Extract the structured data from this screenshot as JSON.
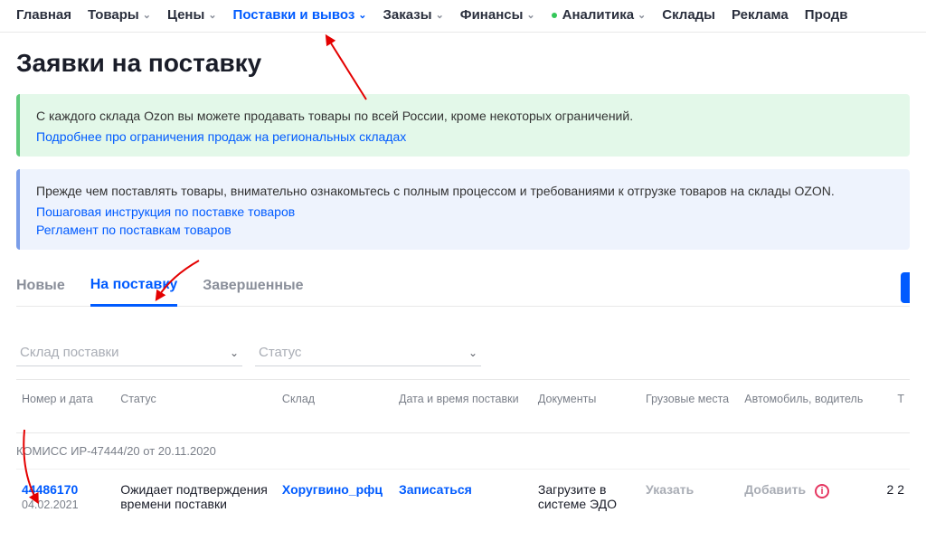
{
  "nav": {
    "items": [
      {
        "label": "Главная",
        "dropdown": false
      },
      {
        "label": "Товары",
        "dropdown": true
      },
      {
        "label": "Цены",
        "dropdown": true
      },
      {
        "label": "Поставки и вывоз",
        "dropdown": true,
        "active": true
      },
      {
        "label": "Заказы",
        "dropdown": true
      },
      {
        "label": "Финансы",
        "dropdown": true
      },
      {
        "label": "Аналитика",
        "dropdown": true,
        "dot": true
      },
      {
        "label": "Склады",
        "dropdown": false
      },
      {
        "label": "Реклама",
        "dropdown": false
      },
      {
        "label": "Продв",
        "dropdown": false
      }
    ]
  },
  "page": {
    "title": "Заявки на поставку"
  },
  "banner_green": {
    "text": "С каждого склада Ozon вы можете продавать товары по всей России, кроме некоторых ограничений.",
    "link": "Подробнее про ограничения продаж на региональных складах"
  },
  "banner_blue": {
    "text": "Прежде чем поставлять товары, внимательно ознакомьтесь с полным процессом и требованиями к отгрузке товаров на склады OZON.",
    "link1": "Пошаговая инструкция по поставке товаров",
    "link2": "Регламент по поставкам товаров"
  },
  "tabs": {
    "items": [
      "Новые",
      "На поставку",
      "Завершенные"
    ],
    "active_index": 1
  },
  "filters": {
    "warehouse_placeholder": "Склад поставки",
    "status_placeholder": "Статус"
  },
  "columns": {
    "num": "Номер и дата",
    "status": "Статус",
    "whs": "Склад",
    "dt": "Дата и время поставки",
    "doc": "Документы",
    "cargo": "Грузовые места",
    "car": "Автомобиль, водитель",
    "last": "Т"
  },
  "group": {
    "label": "КОМИСС ИР-47444/20 от 20.11.2020"
  },
  "row": {
    "id": "44486170",
    "date": "04.02.2021",
    "status": "Ожидает подтверждения времени поставки",
    "warehouse": "Хоругвино_рфц",
    "datetime_action": "Записаться",
    "documents": "Загрузите в системе ЭДО",
    "cargo_action": "Указать",
    "car_action": "Добавить",
    "last": "2\n2"
  }
}
